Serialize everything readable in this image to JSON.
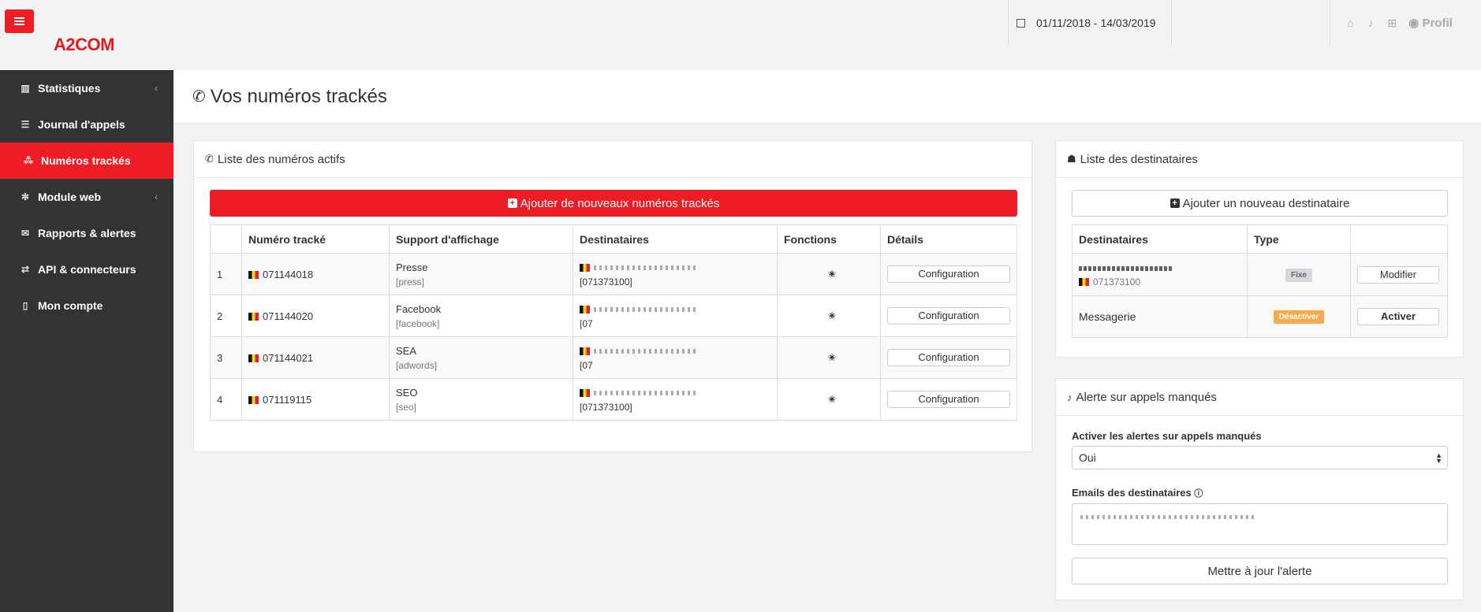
{
  "header": {
    "logo_text": "A2COM",
    "date_range": "01/11/2018 - 14/03/2019",
    "profile_label": "Profil"
  },
  "sidebar": {
    "items": [
      {
        "label": "Statistiques"
      },
      {
        "label": "Journal d'appels"
      },
      {
        "label": "Numéros trackés"
      },
      {
        "label": "Module web"
      },
      {
        "label": "Rapports & alertes"
      },
      {
        "label": "API & connecteurs"
      },
      {
        "label": "Mon compte"
      }
    ]
  },
  "page": {
    "title": "Vos numéros trackés"
  },
  "numbers_panel": {
    "title": "Liste des numéros actifs",
    "add_button": "Ajouter de nouveaux numéros trackés",
    "columns": [
      "",
      "Numéro tracké",
      "Support d'affichage",
      "Destinataires",
      "Fonctions",
      "Détails"
    ],
    "rows": [
      {
        "index": "1",
        "number": "071144018",
        "support": "Presse",
        "support_tag": "[press]",
        "dest_number": "[071373100]",
        "details": "Configuration"
      },
      {
        "index": "2",
        "number": "071144020",
        "support": "Facebook",
        "support_tag": "[facebook]",
        "dest_number": "[07",
        "details": "Configuration"
      },
      {
        "index": "3",
        "number": "071144021",
        "support": "SEA",
        "support_tag": "[adwords]",
        "dest_number": "[07",
        "details": "Configuration"
      },
      {
        "index": "4",
        "number": "071119115",
        "support": "SEO",
        "support_tag": "[seo]",
        "dest_number": "[071373100]",
        "details": "Configuration"
      }
    ]
  },
  "recipients_panel": {
    "title": "Liste des destinataires",
    "add_button": "Ajouter un nouveau destinataire",
    "columns": [
      "Destinataires",
      "Type",
      ""
    ],
    "rows": [
      {
        "number": "071373100",
        "type": "Fixe",
        "action": "Modifier"
      },
      {
        "name": "Messagerie",
        "type": "Désactiver",
        "action": "Activer"
      }
    ]
  },
  "alert_panel": {
    "title": "Alerte sur appels manqués",
    "enable_label": "Activer les alertes sur appels manqués",
    "enable_value": "Oui",
    "emails_label": "Emails des destinataires",
    "update_button": "Mettre à jour l'alerte"
  },
  "colors": {
    "accent": "#ee1c24",
    "sidebar_bg": "#333333",
    "orange_label": "#f7a94b"
  }
}
